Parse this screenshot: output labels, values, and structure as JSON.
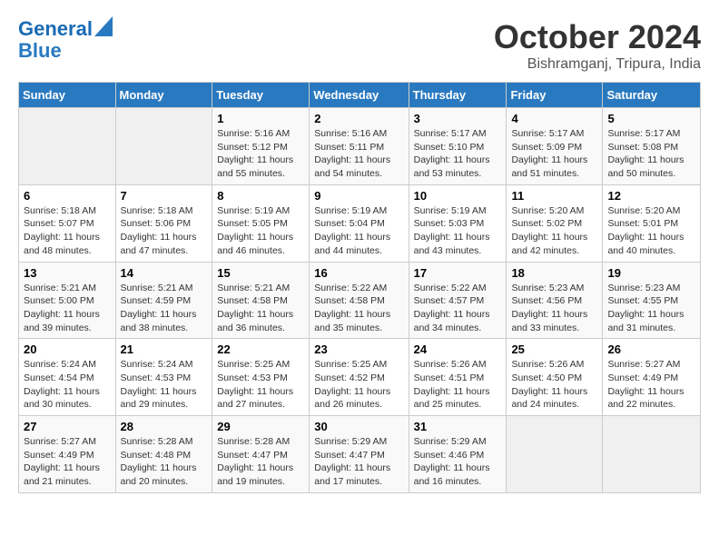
{
  "header": {
    "logo_line1": "General",
    "logo_line2": "Blue",
    "month": "October 2024",
    "location": "Bishramganj, Tripura, India"
  },
  "days_of_week": [
    "Sunday",
    "Monday",
    "Tuesday",
    "Wednesday",
    "Thursday",
    "Friday",
    "Saturday"
  ],
  "weeks": [
    [
      {
        "day": "",
        "info": ""
      },
      {
        "day": "",
        "info": ""
      },
      {
        "day": "1",
        "info": "Sunrise: 5:16 AM\nSunset: 5:12 PM\nDaylight: 11 hours and 55 minutes."
      },
      {
        "day": "2",
        "info": "Sunrise: 5:16 AM\nSunset: 5:11 PM\nDaylight: 11 hours and 54 minutes."
      },
      {
        "day": "3",
        "info": "Sunrise: 5:17 AM\nSunset: 5:10 PM\nDaylight: 11 hours and 53 minutes."
      },
      {
        "day": "4",
        "info": "Sunrise: 5:17 AM\nSunset: 5:09 PM\nDaylight: 11 hours and 51 minutes."
      },
      {
        "day": "5",
        "info": "Sunrise: 5:17 AM\nSunset: 5:08 PM\nDaylight: 11 hours and 50 minutes."
      }
    ],
    [
      {
        "day": "6",
        "info": "Sunrise: 5:18 AM\nSunset: 5:07 PM\nDaylight: 11 hours and 48 minutes."
      },
      {
        "day": "7",
        "info": "Sunrise: 5:18 AM\nSunset: 5:06 PM\nDaylight: 11 hours and 47 minutes."
      },
      {
        "day": "8",
        "info": "Sunrise: 5:19 AM\nSunset: 5:05 PM\nDaylight: 11 hours and 46 minutes."
      },
      {
        "day": "9",
        "info": "Sunrise: 5:19 AM\nSunset: 5:04 PM\nDaylight: 11 hours and 44 minutes."
      },
      {
        "day": "10",
        "info": "Sunrise: 5:19 AM\nSunset: 5:03 PM\nDaylight: 11 hours and 43 minutes."
      },
      {
        "day": "11",
        "info": "Sunrise: 5:20 AM\nSunset: 5:02 PM\nDaylight: 11 hours and 42 minutes."
      },
      {
        "day": "12",
        "info": "Sunrise: 5:20 AM\nSunset: 5:01 PM\nDaylight: 11 hours and 40 minutes."
      }
    ],
    [
      {
        "day": "13",
        "info": "Sunrise: 5:21 AM\nSunset: 5:00 PM\nDaylight: 11 hours and 39 minutes."
      },
      {
        "day": "14",
        "info": "Sunrise: 5:21 AM\nSunset: 4:59 PM\nDaylight: 11 hours and 38 minutes."
      },
      {
        "day": "15",
        "info": "Sunrise: 5:21 AM\nSunset: 4:58 PM\nDaylight: 11 hours and 36 minutes."
      },
      {
        "day": "16",
        "info": "Sunrise: 5:22 AM\nSunset: 4:58 PM\nDaylight: 11 hours and 35 minutes."
      },
      {
        "day": "17",
        "info": "Sunrise: 5:22 AM\nSunset: 4:57 PM\nDaylight: 11 hours and 34 minutes."
      },
      {
        "day": "18",
        "info": "Sunrise: 5:23 AM\nSunset: 4:56 PM\nDaylight: 11 hours and 33 minutes."
      },
      {
        "day": "19",
        "info": "Sunrise: 5:23 AM\nSunset: 4:55 PM\nDaylight: 11 hours and 31 minutes."
      }
    ],
    [
      {
        "day": "20",
        "info": "Sunrise: 5:24 AM\nSunset: 4:54 PM\nDaylight: 11 hours and 30 minutes."
      },
      {
        "day": "21",
        "info": "Sunrise: 5:24 AM\nSunset: 4:53 PM\nDaylight: 11 hours and 29 minutes."
      },
      {
        "day": "22",
        "info": "Sunrise: 5:25 AM\nSunset: 4:53 PM\nDaylight: 11 hours and 27 minutes."
      },
      {
        "day": "23",
        "info": "Sunrise: 5:25 AM\nSunset: 4:52 PM\nDaylight: 11 hours and 26 minutes."
      },
      {
        "day": "24",
        "info": "Sunrise: 5:26 AM\nSunset: 4:51 PM\nDaylight: 11 hours and 25 minutes."
      },
      {
        "day": "25",
        "info": "Sunrise: 5:26 AM\nSunset: 4:50 PM\nDaylight: 11 hours and 24 minutes."
      },
      {
        "day": "26",
        "info": "Sunrise: 5:27 AM\nSunset: 4:49 PM\nDaylight: 11 hours and 22 minutes."
      }
    ],
    [
      {
        "day": "27",
        "info": "Sunrise: 5:27 AM\nSunset: 4:49 PM\nDaylight: 11 hours and 21 minutes."
      },
      {
        "day": "28",
        "info": "Sunrise: 5:28 AM\nSunset: 4:48 PM\nDaylight: 11 hours and 20 minutes."
      },
      {
        "day": "29",
        "info": "Sunrise: 5:28 AM\nSunset: 4:47 PM\nDaylight: 11 hours and 19 minutes."
      },
      {
        "day": "30",
        "info": "Sunrise: 5:29 AM\nSunset: 4:47 PM\nDaylight: 11 hours and 17 minutes."
      },
      {
        "day": "31",
        "info": "Sunrise: 5:29 AM\nSunset: 4:46 PM\nDaylight: 11 hours and 16 minutes."
      },
      {
        "day": "",
        "info": ""
      },
      {
        "day": "",
        "info": ""
      }
    ]
  ]
}
